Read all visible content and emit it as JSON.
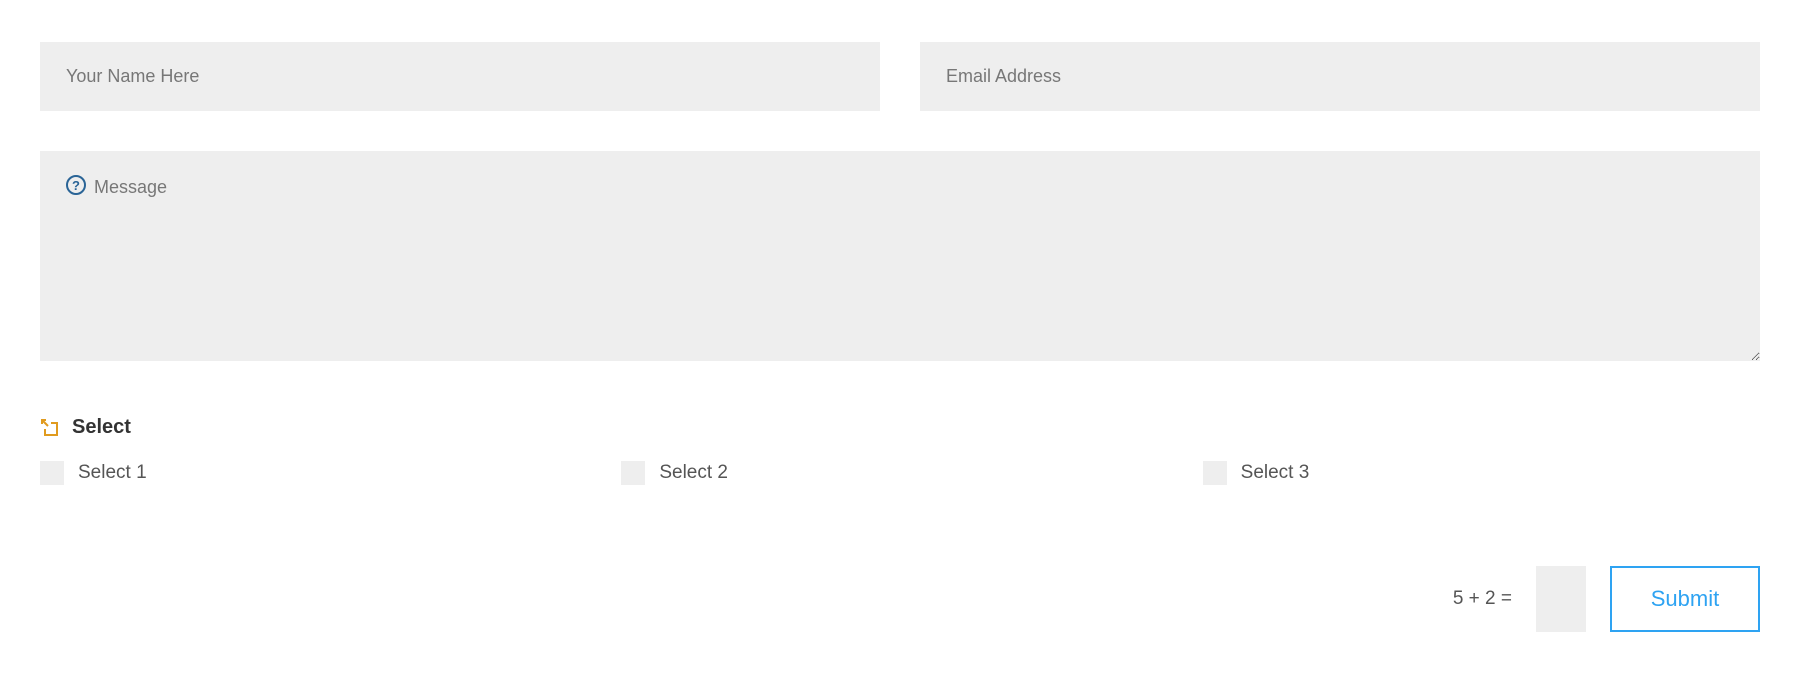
{
  "form": {
    "name": {
      "placeholder": "Your Name Here",
      "value": ""
    },
    "email": {
      "placeholder": "Email Address",
      "value": ""
    },
    "message": {
      "placeholder": "Message",
      "value": "",
      "icon_glyph": "?"
    },
    "select": {
      "title": "Select",
      "options": [
        {
          "label": "Select 1",
          "checked": false
        },
        {
          "label": "Select 2",
          "checked": false
        },
        {
          "label": "Select 3",
          "checked": false
        }
      ]
    },
    "captcha": {
      "question": "5 + 2 =",
      "value": ""
    },
    "submit": {
      "label": "Submit"
    }
  },
  "colors": {
    "input_bg": "#eeeeee",
    "accent_blue": "#2ea3f2",
    "icon_orange": "#e09b1f",
    "help_icon": "#2a6496"
  }
}
